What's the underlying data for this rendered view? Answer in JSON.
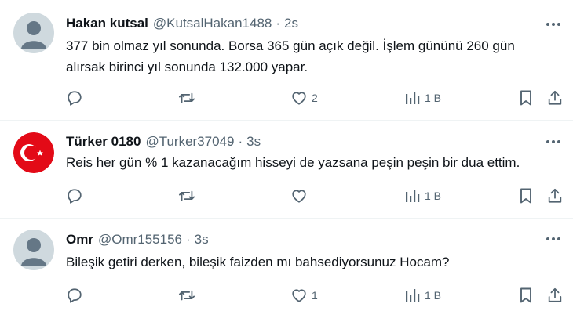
{
  "tweets": [
    {
      "name": "Hakan kutsal",
      "handle": "@KutsalHakan1488",
      "dot": "·",
      "time": "2s",
      "text": "377 bin olmaz yıl sonunda. Borsa 365 gün açık değil. İşlem gününü 260 gün\nalırsak birinci yıl sonunda 132.000 yapar.",
      "avatar": "default",
      "likes": "2",
      "views": "1 B"
    },
    {
      "name": "Türker 0180",
      "handle": "@Turker37049",
      "dot": "·",
      "time": "3s",
      "text": "Reis her gün % 1 kazanacağım hisseyi de yazsana peşin peşin bir dua ettim.",
      "avatar": "turkish-flag",
      "likes": "",
      "views": "1 B"
    },
    {
      "name": "Omr",
      "handle": "@Omr155156",
      "dot": "·",
      "time": "3s",
      "text": "Bileşik getiri derken, bileşik faizden mı bahsediyorsunuz Hocam?",
      "avatar": "default",
      "likes": "1",
      "views": "1 B"
    }
  ],
  "colors": {
    "text": "#0f1419",
    "secondary": "#536471",
    "divider": "#eff3f4",
    "flag_red": "#e30a17",
    "avatar_bg": "#cfd9de"
  },
  "icons": [
    "more-icon",
    "reply-icon",
    "retweet-icon",
    "like-icon",
    "views-icon",
    "bookmark-icon",
    "share-icon"
  ]
}
